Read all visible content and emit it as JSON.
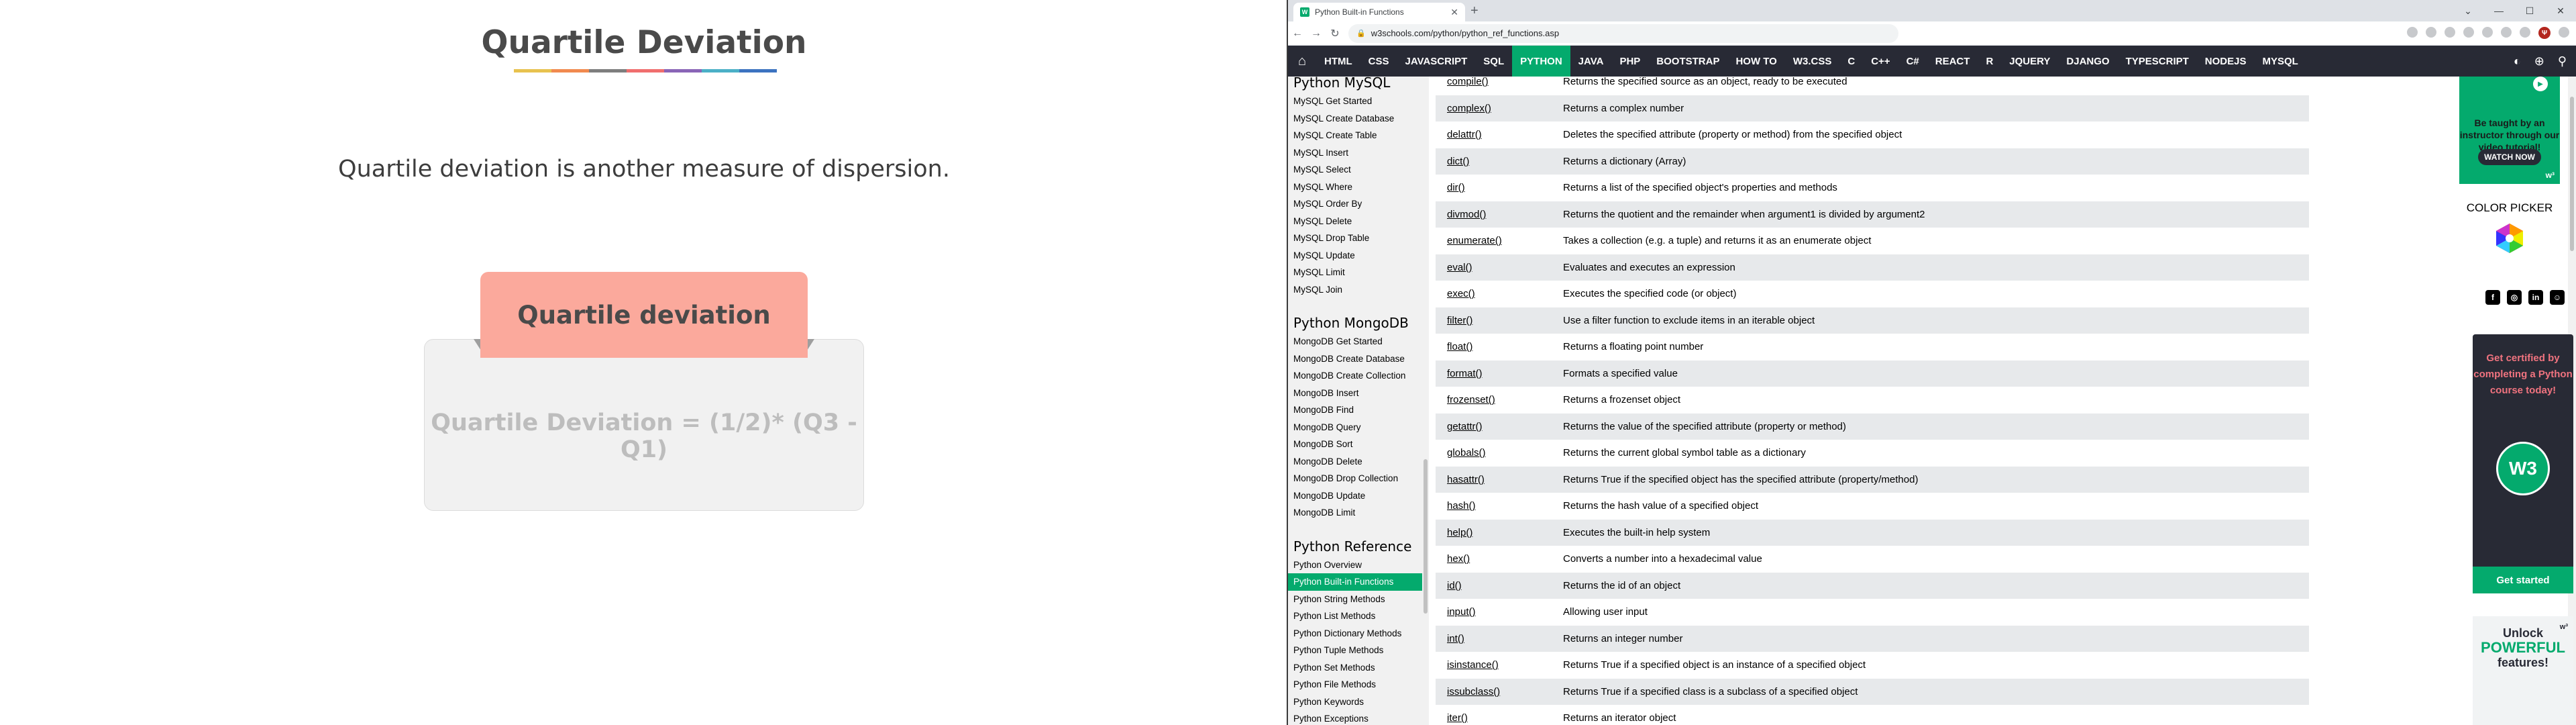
{
  "slide": {
    "title": "Quartile Deviation",
    "underline_colors": [
      "#e8c24f",
      "#f18a4f",
      "#7e7e7e",
      "#f06e6e",
      "#8a65b7",
      "#4bb0c7",
      "#3c73c0"
    ],
    "text": "Quartile deviation is another measure of dispersion.",
    "card_header": "Quartile deviation",
    "card_formula": "Quartile Deviation = (1/2)* (Q3 - Q1)",
    "colors": {
      "header_bg": "#fba99c",
      "card_bg": "#f1f1f1",
      "formula": "#bdbdbd"
    }
  },
  "browser": {
    "tab_title": "Python Built-in Functions",
    "tab_favicon": "W",
    "url": "w3schools.com/python/python_ref_functions.asp",
    "profile_initial": "Ψ",
    "nav": {
      "items": [
        "HTML",
        "CSS",
        "JAVASCRIPT",
        "SQL",
        "PYTHON",
        "JAVA",
        "PHP",
        "BOOTSTRAP",
        "HOW TO",
        "W3.CSS",
        "C",
        "C++",
        "C#",
        "REACT",
        "R",
        "JQUERY",
        "DJANGO",
        "TYPESCRIPT",
        "NODEJS",
        "MYSQL"
      ],
      "active": "PYTHON",
      "accent": "#04aa6d",
      "bg": "#282a35"
    },
    "sidebar": {
      "sections": [
        {
          "heading": "Python MySQL",
          "links": [
            "MySQL Get Started",
            "MySQL Create Database",
            "MySQL Create Table",
            "MySQL Insert",
            "MySQL Select",
            "MySQL Where",
            "MySQL Order By",
            "MySQL Delete",
            "MySQL Drop Table",
            "MySQL Update",
            "MySQL Limit",
            "MySQL Join"
          ]
        },
        {
          "heading": "Python MongoDB",
          "links": [
            "MongoDB Get Started",
            "MongoDB Create Database",
            "MongoDB Create Collection",
            "MongoDB Insert",
            "MongoDB Find",
            "MongoDB Query",
            "MongoDB Sort",
            "MongoDB Delete",
            "MongoDB Drop Collection",
            "MongoDB Update",
            "MongoDB Limit"
          ]
        },
        {
          "heading": "Python Reference",
          "links": [
            "Python Overview",
            "Python Built-in Functions",
            "Python String Methods",
            "Python List Methods",
            "Python Dictionary Methods",
            "Python Tuple Methods",
            "Python Set Methods",
            "Python File Methods",
            "Python Keywords",
            "Python Exceptions"
          ]
        }
      ],
      "active_link": "Python Built-in Functions"
    },
    "functions": [
      {
        "name": "compile()",
        "desc": "Returns the specified source as an object, ready to be executed"
      },
      {
        "name": "complex()",
        "desc": "Returns a complex number"
      },
      {
        "name": "delattr()",
        "desc": "Deletes the specified attribute (property or method) from the specified object"
      },
      {
        "name": "dict()",
        "desc": "Returns a dictionary (Array)"
      },
      {
        "name": "dir()",
        "desc": "Returns a list of the specified object's properties and methods"
      },
      {
        "name": "divmod()",
        "desc": "Returns the quotient and the remainder when argument1 is divided by argument2"
      },
      {
        "name": "enumerate()",
        "desc": "Takes a collection (e.g. a tuple) and returns it as an enumerate object"
      },
      {
        "name": "eval()",
        "desc": "Evaluates and executes an expression"
      },
      {
        "name": "exec()",
        "desc": "Executes the specified code (or object)"
      },
      {
        "name": "filter()",
        "desc": "Use a filter function to exclude items in an iterable object"
      },
      {
        "name": "float()",
        "desc": "Returns a floating point number"
      },
      {
        "name": "format()",
        "desc": "Formats a specified value"
      },
      {
        "name": "frozenset()",
        "desc": "Returns a frozenset object"
      },
      {
        "name": "getattr()",
        "desc": "Returns the value of the specified attribute (property or method)"
      },
      {
        "name": "globals()",
        "desc": "Returns the current global symbol table as a dictionary"
      },
      {
        "name": "hasattr()",
        "desc": "Returns True if the specified object has the specified attribute (property/method)"
      },
      {
        "name": "hash()",
        "desc": "Returns the hash value of a specified object"
      },
      {
        "name": "help()",
        "desc": "Executes the built-in help system"
      },
      {
        "name": "hex()",
        "desc": "Converts a number into a hexadecimal value"
      },
      {
        "name": "id()",
        "desc": "Returns the id of an object"
      },
      {
        "name": "input()",
        "desc": "Allowing user input"
      },
      {
        "name": "int()",
        "desc": "Returns an integer number"
      },
      {
        "name": "isinstance()",
        "desc": "Returns True if a specified object is an instance of a specified object"
      },
      {
        "name": "issubclass()",
        "desc": "Returns True if a specified class is a subclass of a specified object"
      },
      {
        "name": "iter()",
        "desc": "Returns an iterator object"
      }
    ],
    "rail": {
      "video_text": "Be taught by an instructor through our video tutorial!",
      "video_button": "WATCH NOW",
      "color_picker_label": "COLOR PICKER",
      "social_icons": [
        "facebook-icon",
        "instagram-icon",
        "linkedin-icon",
        "discord-icon"
      ],
      "cert_text": "Get certified by completing a Python course today!",
      "cert_badge": "W3",
      "cert_button": "Get started",
      "unlock_line1": "Unlock",
      "unlock_line2": "POWERFUL",
      "unlock_line3": "features!"
    }
  }
}
